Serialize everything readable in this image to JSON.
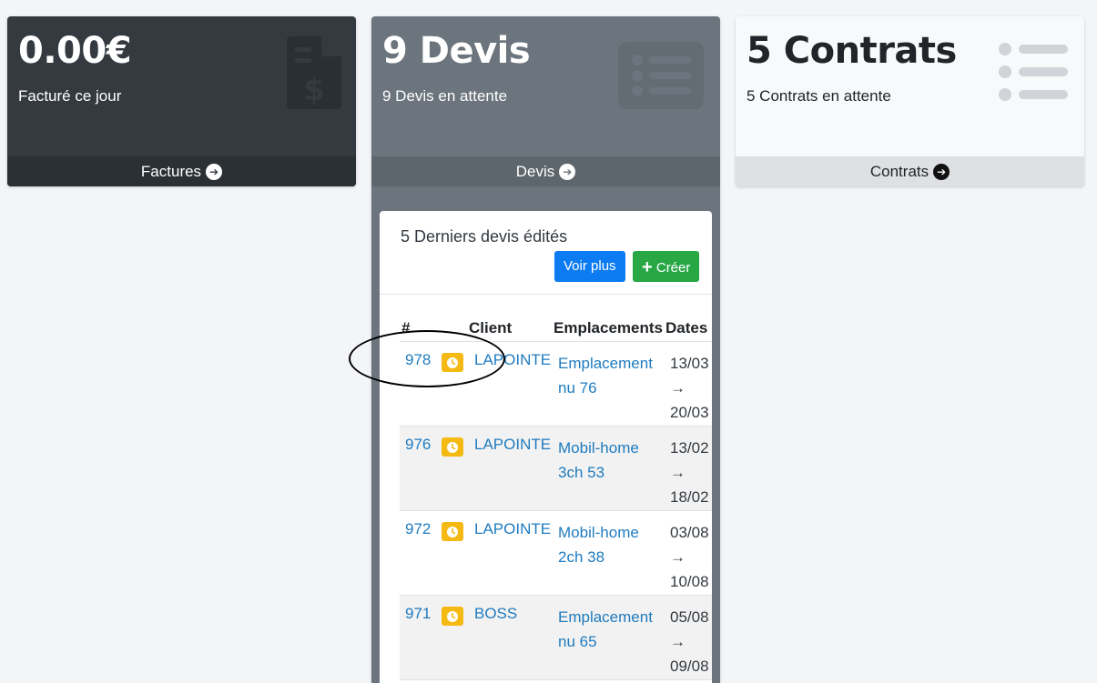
{
  "cards": [
    {
      "title": "0.00€",
      "subtitle": "Facturé ce jour",
      "footer": "Factures",
      "icon": "invoice-dollar-icon"
    },
    {
      "title": "9 Devis",
      "subtitle": "9 Devis en attente",
      "footer": "Devis",
      "icon": "list-icon"
    },
    {
      "title": "5 Contrats",
      "subtitle": "5 Contrats en attente",
      "footer": "Contrats",
      "icon": "list-icon"
    }
  ],
  "recent": {
    "title": "5 Derniers devis édités",
    "more_label": "Voir plus",
    "create_label": "Créer",
    "columns": [
      "#",
      "Client",
      "Emplacements",
      "Dates"
    ],
    "rows": [
      {
        "num": "978",
        "client": "LAPOINTE",
        "empl_1": "Emplacement",
        "empl_2": "nu 76",
        "date_from": "13/03",
        "arrow": "→",
        "date_to": "20/03"
      },
      {
        "num": "976",
        "client": "LAPOINTE",
        "empl_1": "Mobil-home",
        "empl_2": "3ch 53",
        "date_from": "13/02",
        "arrow": "→",
        "date_to": "18/02"
      },
      {
        "num": "972",
        "client": "LAPOINTE",
        "empl_1": "Mobil-home",
        "empl_2": "2ch 38",
        "date_from": "03/08",
        "arrow": "→",
        "date_to": "10/08"
      },
      {
        "num": "971",
        "client": "BOSS",
        "empl_1": "Emplacement",
        "empl_2": "nu 65",
        "date_from": "05/08",
        "arrow": "→",
        "date_to": "09/08"
      }
    ]
  },
  "colors": {
    "dark": "#343a40",
    "secondary": "#6c757d",
    "light": "#f8f9fa",
    "primary": "#0d7cf2",
    "success": "#28a745",
    "warning": "#f5b914",
    "link": "#1f7bbf"
  }
}
